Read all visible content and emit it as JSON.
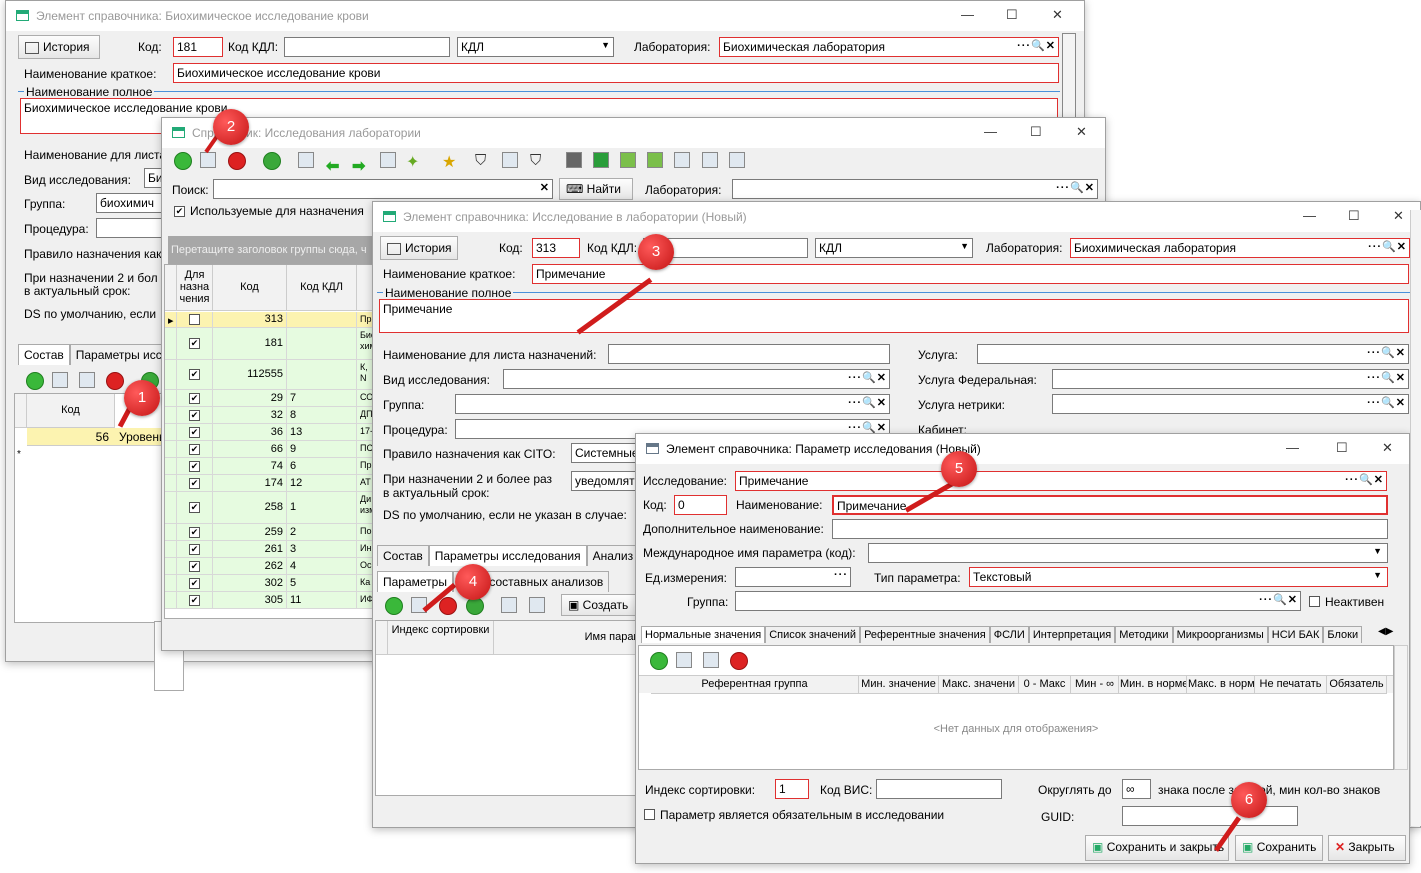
{
  "w1": {
    "title": "Элемент справочника: Биохимическое исследование крови",
    "history": "История",
    "code_label": "Код:",
    "code": "181",
    "kdl_label": "Код КДЛ:",
    "kdl_select": "КДЛ",
    "lab_label": "Лаборатория:",
    "lab": "Биохимическая лаборатория",
    "short_label": "Наименование краткое:",
    "short": "Биохимическое исследование крови",
    "full_label": "Наименование полное",
    "full": "Биохимическое исследование крови",
    "list_label": "Наименование для листа",
    "kind_label": "Вид исследования:",
    "kind": "Би",
    "group_label": "Группа:",
    "group": "биохимич",
    "proc_label": "Процедура:",
    "rule_label": "Правило назначения как",
    "when2a": "При назначении 2 и бол",
    "when2b": "в актуальный срок:",
    "ds_label": "DS по умолчанию, если",
    "tab1": "Состав",
    "tab2": "Параметры исс",
    "col_code": "Код",
    "row_code": "56",
    "row_val": "Уровень"
  },
  "w2": {
    "title": "Справочник: Исследования лаборатории",
    "search_label": "Поиск:",
    "find": "Найти",
    "lab_label": "Лаборатория:",
    "used": "Используемые для назначения",
    "group_hint": "Перетащите заголовок группы сюда, ч",
    "col_for": "Для назна чения",
    "col_code": "Код",
    "col_kdl": "Код КДЛ",
    "rows": [
      {
        "c": "313",
        "k": "",
        "n": "При"
      },
      {
        "c": "181",
        "k": "",
        "n": "Био хим"
      },
      {
        "c": "112555",
        "k": "",
        "n": "К, N"
      },
      {
        "c": "29",
        "k": "7",
        "n": "СО"
      },
      {
        "c": "32",
        "k": "8",
        "n": "ДП"
      },
      {
        "c": "36",
        "k": "13",
        "n": "17-"
      },
      {
        "c": "66",
        "k": "9",
        "n": "ПС"
      },
      {
        "c": "74",
        "k": "6",
        "n": "Пр"
      },
      {
        "c": "174",
        "k": "12",
        "n": "АТ"
      },
      {
        "c": "258",
        "k": "1",
        "n": "Ди изм"
      },
      {
        "c": "259",
        "k": "2",
        "n": "По"
      },
      {
        "c": "261",
        "k": "3",
        "n": "Ин"
      },
      {
        "c": "262",
        "k": "4",
        "n": "Ос"
      },
      {
        "c": "302",
        "k": "5",
        "n": "Ка"
      },
      {
        "c": "305",
        "k": "11",
        "n": "ИФ"
      }
    ]
  },
  "w3": {
    "title": "Элемент справочника: Исследование в лаборатории (Новый)",
    "history": "История",
    "code_label": "Код:",
    "code": "313",
    "kdl_label": "Код КДЛ:",
    "kdl_select": "КДЛ",
    "lab_label": "Лаборатория:",
    "lab": "Биохимическая лаборатория",
    "short_label": "Наименование краткое:",
    "short": "Примечание",
    "full_label": "Наименование полное",
    "full": "Примечание",
    "list_label": "Наименование для листа назначений:",
    "service_label": "Услуга:",
    "kind_label": "Вид исследования:",
    "service_fed_label": "Услуга Федеральная:",
    "group_label": "Группа:",
    "service_metr_label": "Услуга нетрики:",
    "proc_label": "Процедура:",
    "cab_label": "Кабинет:",
    "cito_label": "Правило назначения как CITO:",
    "cito": "Системные",
    "when2a": "При назначении 2 и более раз",
    "when2b": "в актуальный срок:",
    "when2": "уведомлят",
    "ds_label": "DS по умолчанию, если не указан в случае:",
    "tab1": "Состав",
    "tab2": "Параметры исследования",
    "tab3": "Анализ",
    "sub1": "Параметры",
    "sub2": "етры составных анализов",
    "create": "Создать",
    "col_sort": "Индекс сортировки",
    "col_name": "Имя парам"
  },
  "w4": {
    "title": "Элемент справочника: Параметр исследования (Новый)",
    "study_label": "Исследование:",
    "study": "Примечание",
    "code_label": "Код:",
    "code": "0",
    "name_label": "Наименование:",
    "name": "Примечание",
    "addname_label": "Дополнительное наименование:",
    "intl_label": "Международное имя параметра (код):",
    "unit_label": "Ед.измерения:",
    "type_label": "Тип параметра:",
    "type": "Текстовый",
    "group_label": "Группа:",
    "inactive": "Неактивен",
    "tabs": [
      "Нормальные значения",
      "Список значений",
      "Референтные значения",
      "ФСЛИ",
      "Интерпретация",
      "Методики",
      "Микроорганизмы",
      "НСИ БАК",
      "Блоки"
    ],
    "cols": [
      "Референтная группа",
      "Мин. значение",
      "Макс. значени",
      "0 - Макс",
      "Мин - ∞",
      "Мин. в норме",
      "Макс. в норме",
      "Не печатать",
      "Обязатель"
    ],
    "nodata": "<Нет данных для отображения>",
    "sort_label": "Индекс сортировки:",
    "sort": "1",
    "vis_label": "Код ВИС:",
    "round_label": "Округлять до",
    "round": "∞",
    "round_tail": "знака после запятой, мин кол-во знаков",
    "required": "Параметр является обязательным в исследовании",
    "guid_label": "GUID:",
    "save_close": "Сохранить и закрыть",
    "save": "Сохранить",
    "close": "Закрыть"
  },
  "badges": [
    "1",
    "2",
    "3",
    "4",
    "5",
    "6"
  ]
}
